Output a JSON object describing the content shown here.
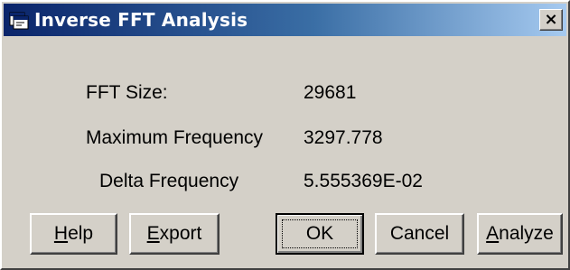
{
  "window": {
    "title": "Inverse FFT Analysis",
    "close_label": "×"
  },
  "fields": [
    {
      "label": "FFT Size:",
      "value": "29681"
    },
    {
      "label": "Maximum Frequency",
      "value": "3297.778"
    },
    {
      "label": "Delta Frequency",
      "value": "5.555369E-02"
    }
  ],
  "buttons": {
    "help": {
      "mnemonic": "H",
      "rest": "elp"
    },
    "export": {
      "mnemonic": "E",
      "rest": "xport"
    },
    "ok": {
      "label": "OK"
    },
    "cancel": {
      "label": "Cancel"
    },
    "analyze": {
      "mnemonic": "A",
      "rest": "nalyze"
    }
  },
  "colors": {
    "face": "#d4d0c8",
    "titlebar_start": "#0a246a",
    "titlebar_end": "#a6caf0"
  },
  "icons": {
    "app": "dialog-window-icon",
    "close": "close-icon"
  }
}
